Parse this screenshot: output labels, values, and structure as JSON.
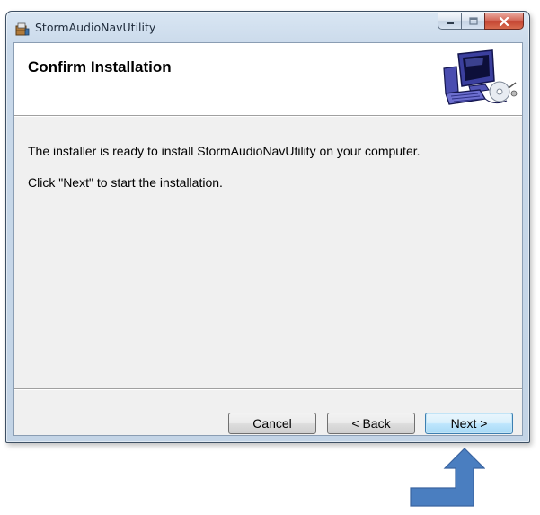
{
  "window": {
    "title": "StormAudioNavUtility",
    "app_icon": "installer-package-icon",
    "caption_buttons": [
      "minimize-icon",
      "maximize-icon",
      "close-icon"
    ]
  },
  "header": {
    "title": "Confirm Installation",
    "banner_icon": "computer-with-disc-icon"
  },
  "body": {
    "line1": "The installer is ready to install StormAudioNavUtility on your computer.",
    "line2": "Click \"Next\" to start the installation."
  },
  "buttons": {
    "cancel": "Cancel",
    "back": "< Back",
    "next": "Next >"
  },
  "annotation": {
    "icon": "up-arrow-pointer-icon",
    "color": "#4a7ec0"
  }
}
